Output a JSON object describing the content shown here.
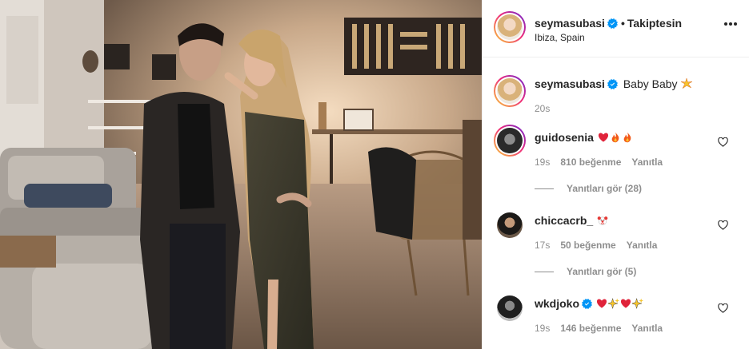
{
  "post": {
    "author": "seymasubasi",
    "separator": "•",
    "follow_status": "Takiptesin",
    "location": "Ibiza, Spain",
    "caption": "Baby Baby",
    "caption_emoji": "star-burst-emoji-icon",
    "posted_ago": "20s"
  },
  "comments": [
    {
      "username": "guidosenia",
      "text": "",
      "emojis": [
        "red-heart-emoji",
        "fire-emoji",
        "fire-emoji"
      ],
      "time": "19s",
      "likes": "810 beğenme",
      "reply": "Yanıtla",
      "view_replies": "Yanıtları gör (28)"
    },
    {
      "username": "chiccacrb_",
      "text": "",
      "emojis": [
        "clown-face-emoji"
      ],
      "time": "17s",
      "likes": "50 beğenme",
      "reply": "Yanıtla",
      "view_replies": "Yanıtları gör (5)"
    },
    {
      "username": "wkdjoko",
      "text": "",
      "emojis": [
        "red-heart-emoji",
        "sparkle-star-emoji",
        "red-heart-emoji",
        "sparkle-star-emoji"
      ],
      "time": "19s",
      "likes": "146 beğenme",
      "reply": "Yanıtla"
    }
  ],
  "colors": {
    "accent": "#0095f6",
    "text": "#262626",
    "secondary": "#8e8e8e",
    "heart": "#ed4956",
    "border": "#efefef"
  }
}
